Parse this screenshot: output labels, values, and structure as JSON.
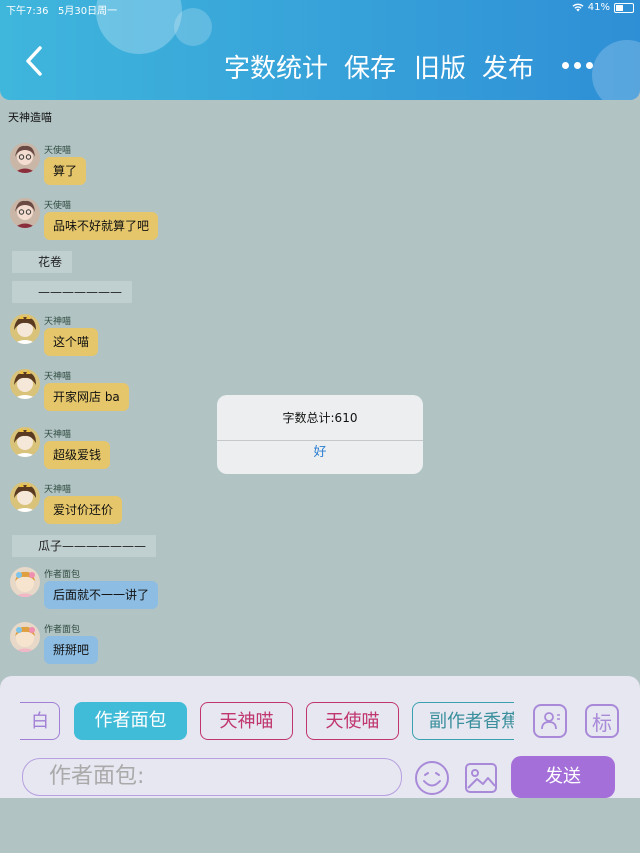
{
  "status": {
    "time": "下午7:36",
    "date": "5月30日周一",
    "battery": "41%"
  },
  "nav": {
    "word_count": "字数统计",
    "save": "保存",
    "old_version": "旧版",
    "publish": "发布"
  },
  "section_title": "天神造喵",
  "messages": [
    {
      "type": "chat",
      "sender": "天使喵",
      "text": "算了",
      "style": "yellow",
      "avatar": "angel-avatar"
    },
    {
      "type": "chat",
      "sender": "天使喵",
      "text": "品味不好就算了吧",
      "style": "yellow",
      "avatar": "angel-avatar"
    },
    {
      "type": "narration",
      "text": "花卷"
    },
    {
      "type": "narration",
      "text": "———————"
    },
    {
      "type": "chat",
      "sender": "天神喵",
      "text": "这个喵",
      "style": "yellow",
      "avatar": "god-avatar"
    },
    {
      "type": "chat",
      "sender": "天神喵",
      "text": "开家网店 ba",
      "style": "yellow",
      "avatar": "god-avatar"
    },
    {
      "type": "chat",
      "sender": "天神喵",
      "text": "超级爱钱",
      "style": "yellow",
      "avatar": "god-avatar"
    },
    {
      "type": "chat",
      "sender": "天神喵",
      "text": "爱讨价还价",
      "style": "yellow",
      "avatar": "god-avatar"
    },
    {
      "type": "narration",
      "text": "瓜子———————"
    },
    {
      "type": "chat",
      "sender": "作者面包",
      "text": "后面就不一一讲了",
      "style": "blue",
      "avatar": "bread-avatar"
    },
    {
      "type": "chat",
      "sender": "作者面包",
      "text": "掰掰吧",
      "style": "blue",
      "avatar": "bread-avatar"
    }
  ],
  "dialog": {
    "message": "字数总计:610",
    "ok": "好"
  },
  "roles": [
    {
      "label": "白",
      "style": "purple"
    },
    {
      "label": "作者面包",
      "style": "active"
    },
    {
      "label": "天神喵",
      "style": "pink"
    },
    {
      "label": "天使喵",
      "style": "pink"
    },
    {
      "label": "副作者香蕉",
      "style": "teal"
    }
  ],
  "toolbar": {
    "mark_label": "标",
    "input_placeholder": "作者面包:",
    "send": "发送"
  }
}
